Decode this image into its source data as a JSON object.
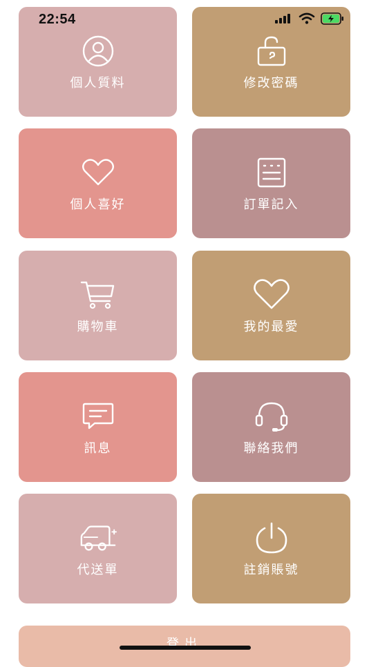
{
  "status_bar": {
    "time": "22:54"
  },
  "colors": {
    "dusty_pink": "#d6aeae",
    "salmon": "#e3958e",
    "tan": "#c19e74",
    "mauve": "#ba9090",
    "logout": "#e9bba8"
  },
  "tiles": [
    {
      "label": "個人質料",
      "icon": "person-icon",
      "color": "#d6aeae"
    },
    {
      "label": "修改密碼",
      "icon": "unlock-icon",
      "color": "#c19e74"
    },
    {
      "label": "個人喜好",
      "icon": "heart-outline-icon",
      "color": "#e3958e"
    },
    {
      "label": "訂單記入",
      "icon": "order-record-icon",
      "color": "#ba9090"
    },
    {
      "label": "購物車",
      "icon": "cart-icon",
      "color": "#d6aeae"
    },
    {
      "label": "我的最愛",
      "icon": "heart-icon",
      "color": "#c19e74"
    },
    {
      "label": "訊息",
      "icon": "message-icon",
      "color": "#e3958e"
    },
    {
      "label": "聯絡我們",
      "icon": "headset-icon",
      "color": "#ba9090"
    },
    {
      "label": "代送單",
      "icon": "delivery-car-icon",
      "color": "#d6aeae"
    },
    {
      "label": "註銷賬號",
      "icon": "power-icon",
      "color": "#c19e74"
    }
  ],
  "logout": {
    "label": "登出"
  }
}
